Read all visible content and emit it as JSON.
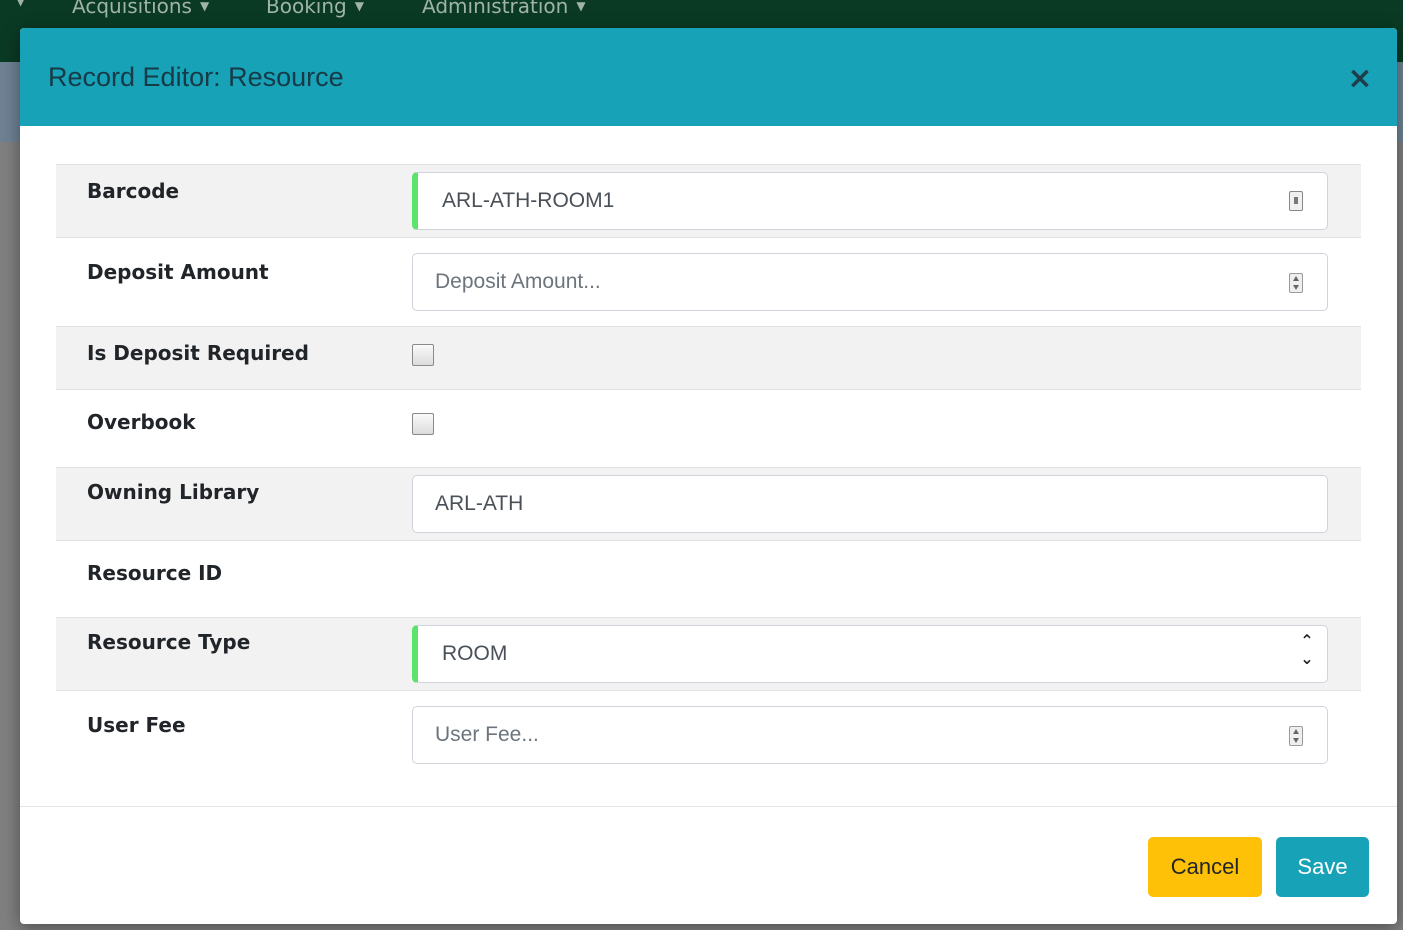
{
  "background": {
    "nav_items": [
      {
        "label": "Acquisitions"
      },
      {
        "label": "Booking"
      },
      {
        "label": "Administration"
      }
    ]
  },
  "modal": {
    "title": "Record Editor: Resource",
    "close_glyph": "×",
    "fields": {
      "barcode": {
        "label": "Barcode",
        "value": "ARL-ATH-ROOM1"
      },
      "deposit_amount": {
        "label": "Deposit Amount",
        "placeholder": "Deposit Amount..."
      },
      "is_deposit_required": {
        "label": "Is Deposit Required",
        "checked": false
      },
      "overbook": {
        "label": "Overbook",
        "checked": false
      },
      "owning_library": {
        "label": "Owning Library",
        "value": "ARL-ATH"
      },
      "resource_id": {
        "label": "Resource ID",
        "value": ""
      },
      "resource_type": {
        "label": "Resource Type",
        "value": "ROOM"
      },
      "user_fee": {
        "label": "User Fee",
        "placeholder": "User Fee..."
      }
    },
    "footer": {
      "cancel_label": "Cancel",
      "save_label": "Save"
    }
  },
  "colors": {
    "header_bg": "#17a2b8",
    "valid_indicator": "#5be36b",
    "cancel_bg": "#ffc107",
    "save_bg": "#17a2b8"
  },
  "icons": {
    "barcode_field": "lock-icon",
    "numeric_fields": "spinner-icon",
    "select": "chevron-updown-icon"
  }
}
